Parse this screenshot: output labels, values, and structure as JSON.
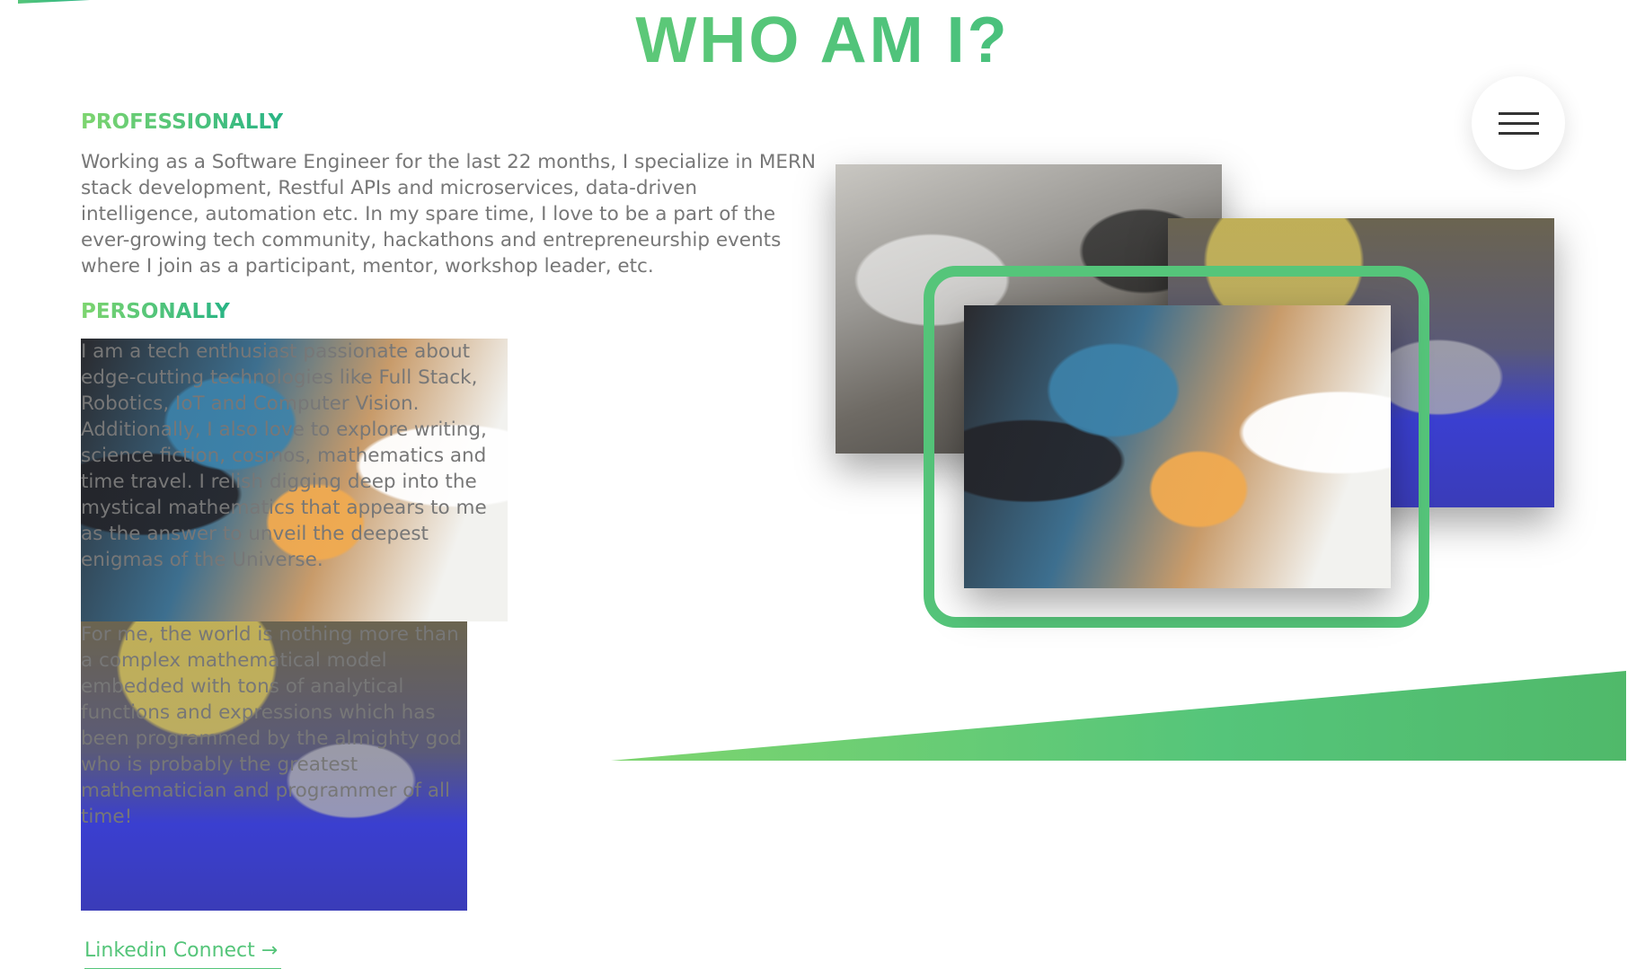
{
  "section": {
    "title": "WHO AM I?"
  },
  "about": {
    "professionally_heading": "PROFESSIONALLY",
    "professionally_text": "Working as a Software Engineer for the last 22 months, I specialize in MERN stack development, Restful APIs and microservices, data-driven intelligence, automation etc. In my spare time, I love to be a part of the ever-growing tech community, hackathons and entrepreneurship events where I join as a participant, mentor, workshop leader, etc.",
    "personally_heading": "PERSONALLY",
    "personally_text_1": "I am a tech enthusiast passionate about edge-cutting technologies like Full Stack, Robotics, IoT and Computer Vision. Additionally, I also love to explore writing, science fiction, cosmos, mathematics and time travel. I relish digging deep into the mystical mathematics that appears to me as the answer to unveil the deepest enigmas of the Universe.",
    "personally_text_2": "For me, the world is nothing more than a complex mathematical model embedded with tons of analytical functions and expressions which has been programmed by the almighty god who is probably the greatest mathematician and programmer of all time!",
    "link_label": "Linkedin Connect →"
  },
  "navigation": {
    "menu_icon": "hamburger-menu-icon"
  },
  "theme": {
    "accent_light": "#7ed56f",
    "accent": "#55c57a",
    "accent_dark": "#28b485",
    "text_color": "#777777"
  }
}
